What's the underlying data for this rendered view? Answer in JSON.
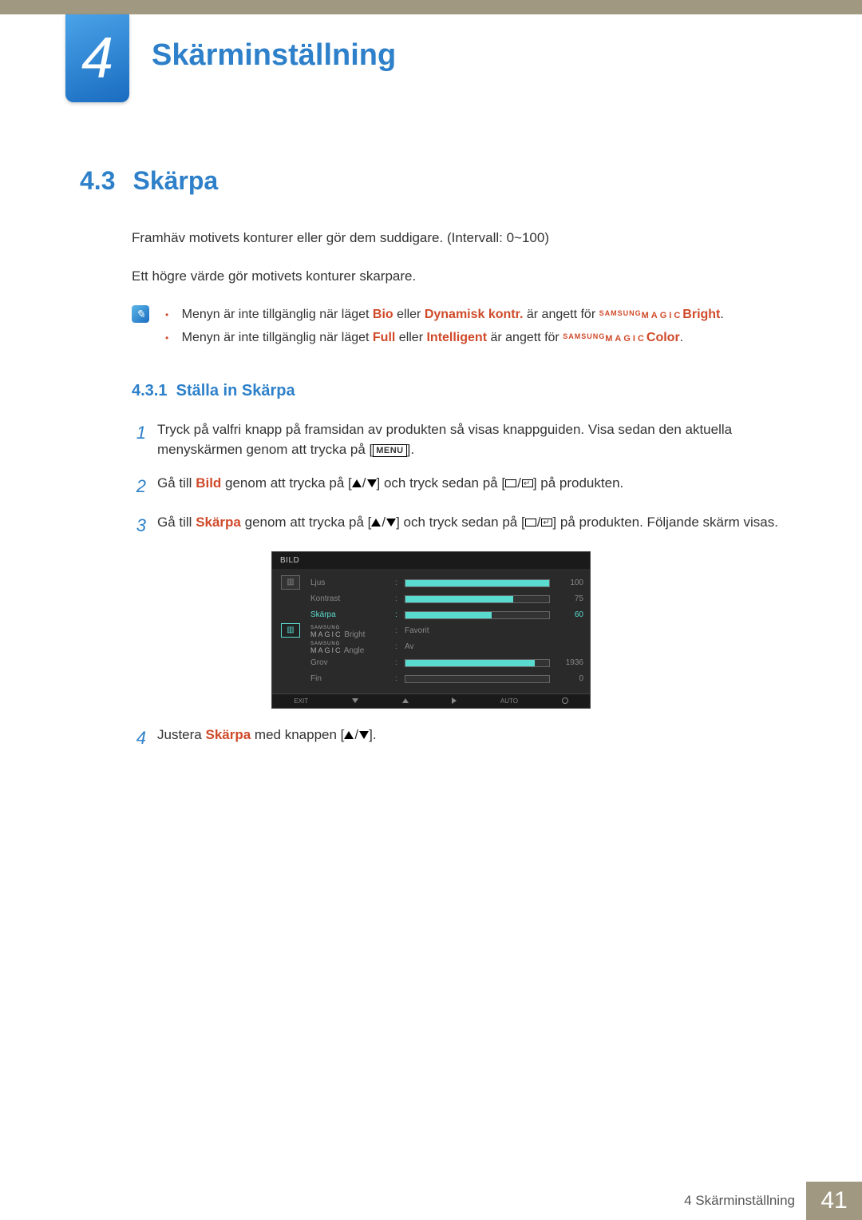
{
  "chapter": {
    "number": "4",
    "title": "Skärminställning"
  },
  "section": {
    "number": "4.3",
    "title": "Skärpa",
    "intro1": "Framhäv motivets konturer eller gör dem suddigare. (Intervall: 0~100)",
    "intro2": "Ett högre värde gör motivets konturer skarpare."
  },
  "notes": {
    "n1_pre": "Menyn är inte tillgänglig när läget ",
    "n1_kw1": "Bio",
    "n1_mid": " eller ",
    "n1_kw2": "Dynamisk kontr.",
    "n1_post": " är angett för ",
    "n1_brand_s": "SAMSUNG",
    "n1_brand_m": "MAGIC",
    "n1_suffix": "Bright",
    "n1_end": ".",
    "n2_pre": "Menyn är inte tillgänglig när läget ",
    "n2_kw1": "Full",
    "n2_mid": " eller ",
    "n2_kw2": "Intelligent",
    "n2_post": " är angett för ",
    "n2_brand_s": "SAMSUNG",
    "n2_brand_m": "MAGIC",
    "n2_suffix": "Color",
    "n2_end": "."
  },
  "subsection": {
    "number": "4.3.1",
    "title": "Ställa in Skärpa"
  },
  "steps": {
    "s1": {
      "num": "1",
      "text": "Tryck på valfri knapp på framsidan av produkten så visas knappguiden. Visa sedan den aktuella menyskärmen genom att trycka på [",
      "menu": "MENU",
      "text_end": "]."
    },
    "s2": {
      "num": "2",
      "pre": "Gå till ",
      "kw": "Bild",
      "mid": " genom att trycka på [",
      "post1": "] och tryck sedan på [",
      "post2": "] på produkten."
    },
    "s3": {
      "num": "3",
      "pre": "Gå till ",
      "kw": "Skärpa",
      "mid": " genom att trycka på [",
      "post1": "] och tryck sedan på [",
      "post2": "] på produkten. Följande skärm visas."
    },
    "s4": {
      "num": "4",
      "pre": "Justera ",
      "kw": "Skärpa",
      "post": " med knappen [",
      "end": "]."
    }
  },
  "osd": {
    "title": "BILD",
    "rows": [
      {
        "label": "Ljus",
        "value": "100",
        "pct": 100,
        "type": "bar"
      },
      {
        "label": "Kontrast",
        "value": "75",
        "pct": 75,
        "type": "bar"
      },
      {
        "label": "Skärpa",
        "value": "60",
        "pct": 60,
        "type": "bar",
        "hl": true
      },
      {
        "label": "MAGIC_Bright",
        "value": "Favorit",
        "type": "text"
      },
      {
        "label": "MAGIC_Angle",
        "value": "Av",
        "type": "text"
      },
      {
        "label": "Grov",
        "value": "1936",
        "pct": 90,
        "type": "bar"
      },
      {
        "label": "Fin",
        "value": "0",
        "pct": 0,
        "type": "bar"
      }
    ],
    "footer": {
      "exit": "EXIT",
      "auto": "AUTO"
    },
    "magic": {
      "samsung": "SAMSUNG",
      "magic": "MAGIC",
      "bright": " Bright",
      "angle": " Angle"
    }
  },
  "footer": {
    "text": "4 Skärminställning",
    "page": "41"
  }
}
